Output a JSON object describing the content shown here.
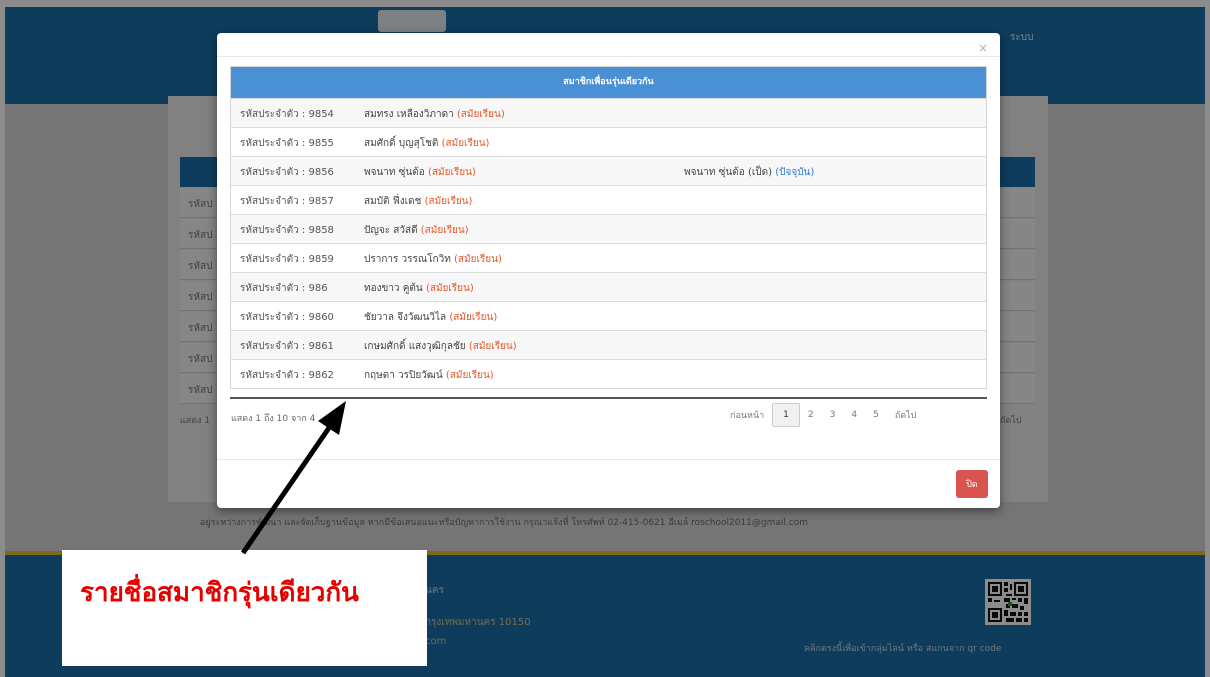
{
  "background": {
    "header_text": "ระบบ",
    "row_label": "รหัสป",
    "row_count": 7,
    "count_text": "แสดง 1",
    "next_text": "ถัดไป",
    "footnote": "อยู่ระหว่างการพัฒนา และจัดเก็บฐานข้อมูล หากมีข้อเสนอแนะหรือปัญหาการใช้งาน กรุณาแจ้งที่ โทรศัพท์ 02-415-0621 อีเมล์ roschool2011@gmail.com",
    "footer_line1": "นคร",
    "footer_line2": "กรุงเทพมหานคร 10150",
    "footer_line3": "com",
    "qr_label": "คลิกตรงนี้เพื่อเข้ากลุ่มไลน์ หรือ สแกนจาก qr code"
  },
  "modal": {
    "close_glyph": "×",
    "table_title": "สมาชิกเพื่อนรุ่นเดียวกัน",
    "rows": [
      {
        "id": "รหัสประจำตัว : 9854",
        "name": "สมทรง เหลืองวิภาดา",
        "status": "(สมัยเรียน)",
        "now_name": "",
        "now_status": ""
      },
      {
        "id": "รหัสประจำตัว : 9855",
        "name": "สมศักดิ์ บุญสุโชติ",
        "status": "(สมัยเรียน)",
        "now_name": "",
        "now_status": ""
      },
      {
        "id": "รหัสประจำตัว : 9856",
        "name": "พจนาท ซุ่นต้อ",
        "status": "(สมัยเรียน)",
        "now_name": "พจนาท ซุ่นต้อ (เป็ด)",
        "now_status": "(ปัจจุบัน)"
      },
      {
        "id": "รหัสประจำตัว : 9857",
        "name": "สมบัติ ฟึ่งเดช",
        "status": "(สมัยเรียน)",
        "now_name": "",
        "now_status": ""
      },
      {
        "id": "รหัสประจำตัว : 9858",
        "name": "ปัญจะ สวัสดี",
        "status": "(สมัยเรียน)",
        "now_name": "",
        "now_status": ""
      },
      {
        "id": "รหัสประจำตัว : 9859",
        "name": "ปราการ วรรณโกวิท",
        "status": "(สมัยเรียน)",
        "now_name": "",
        "now_status": ""
      },
      {
        "id": "รหัสประจำตัว : 986",
        "name": "ทองขาว คูต้น",
        "status": "(สมัยเรียน)",
        "now_name": "",
        "now_status": ""
      },
      {
        "id": "รหัสประจำตัว : 9860",
        "name": "ชัยวาล จึงวัฒนวิไล",
        "status": "(สมัยเรียน)",
        "now_name": "",
        "now_status": ""
      },
      {
        "id": "รหัสประจำตัว : 9861",
        "name": "เกษมศักดิ์ แสงวุฒิกุลชัย",
        "status": "(สมัยเรียน)",
        "now_name": "",
        "now_status": ""
      },
      {
        "id": "รหัสประจำตัว : 9862",
        "name": "กฤษดา วรปิยวัฒน์",
        "status": "(สมัยเรียน)",
        "now_name": "",
        "now_status": ""
      }
    ],
    "count_text": "แสดง 1 ถึง 10 จาก 4",
    "pager": {
      "prev": "ก่อนหน้า",
      "pages": [
        "1",
        "2",
        "3",
        "4",
        "5"
      ],
      "active_page": "1",
      "next": "ถัดไป"
    },
    "close_button": "ปิด"
  },
  "annotation": {
    "callout_text": "รายชื่อสมาชิกรุ่นเดียวกัน",
    "color": "#e60000"
  },
  "colors": {
    "brand_blue": "#1a6ea8",
    "table_header": "#4a90d4",
    "status_past": "#e3582b",
    "status_now": "#2b7bd6",
    "close_button": "#d9534f"
  }
}
